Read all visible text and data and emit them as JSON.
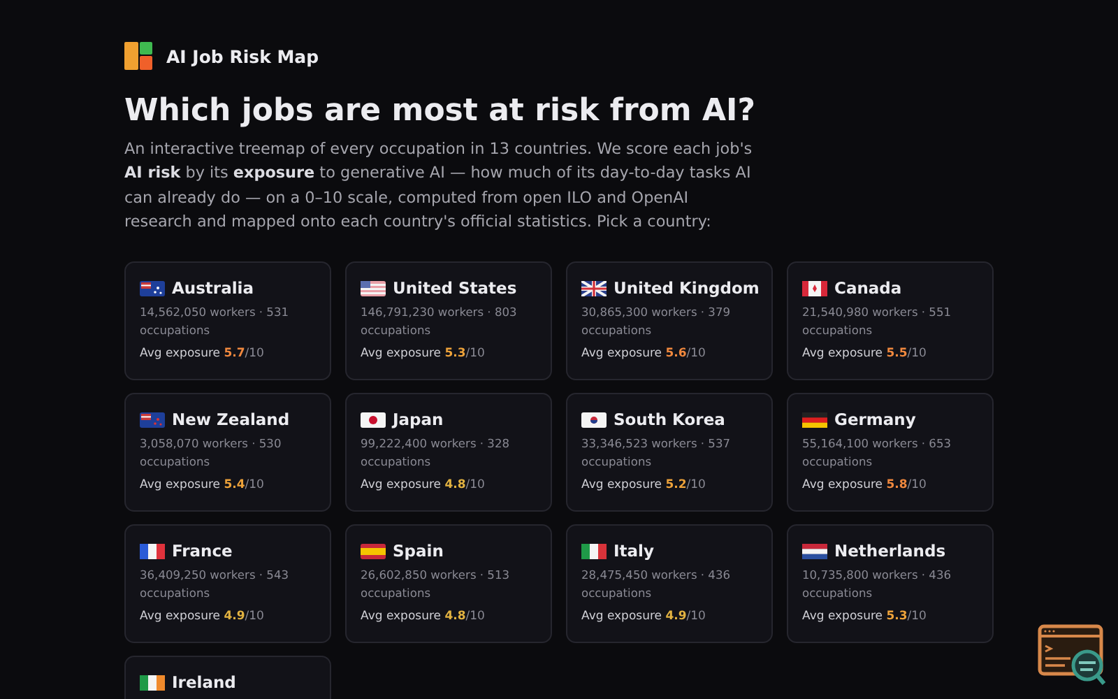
{
  "app": {
    "title": "AI Job Risk Map"
  },
  "heading": "Which jobs are most at risk from AI?",
  "intro": "An interactive treemap of every occupation in 13 countries. We score each job's **AI risk** by its **exposure** to generative AI — how much of its day-to-day tasks AI can already do — on a 0–10 scale, computed from open ILO and OpenAI research and mapped onto each country's official statistics. Pick a country:",
  "countries": [
    {
      "kind": "au",
      "name": "Australia",
      "stats": "14,562,050 workers · 531 occupations",
      "exposure_label": "Avg exposure",
      "score": "5.7",
      "scale": "/10"
    },
    {
      "kind": "us",
      "name": "United States",
      "stats": "146,791,230 workers · 803 occupations",
      "exposure_label": "Avg exposure",
      "score": "5.3",
      "scale": "/10"
    },
    {
      "kind": "gb",
      "name": "United Kingdom",
      "stats": "30,865,300 workers · 379 occupations",
      "exposure_label": "Avg exposure",
      "score": "5.6",
      "scale": "/10"
    },
    {
      "kind": "ca",
      "name": "Canada",
      "stats": "21,540,980 workers · 551 occupations",
      "exposure_label": "Avg exposure",
      "score": "5.5",
      "scale": "/10"
    },
    {
      "kind": "nz",
      "name": "New Zealand",
      "stats": "3,058,070 workers · 530 occupations",
      "exposure_label": "Avg exposure",
      "score": "5.4",
      "scale": "/10"
    },
    {
      "kind": "jp",
      "name": "Japan",
      "stats": "99,222,400 workers · 328 occupations",
      "exposure_label": "Avg exposure",
      "score": "4.8",
      "scale": "/10"
    },
    {
      "kind": "kr",
      "name": "South Korea",
      "stats": "33,346,523 workers · 537 occupations",
      "exposure_label": "Avg exposure",
      "score": "5.2",
      "scale": "/10"
    },
    {
      "kind": "de",
      "name": "Germany",
      "stats": "55,164,100 workers · 653 occupations",
      "exposure_label": "Avg exposure",
      "score": "5.8",
      "scale": "/10"
    },
    {
      "kind": "fr",
      "name": "France",
      "stats": "36,409,250 workers · 543 occupations",
      "exposure_label": "Avg exposure",
      "score": "4.9",
      "scale": "/10"
    },
    {
      "kind": "es",
      "name": "Spain",
      "stats": "26,602,850 workers · 513 occupations",
      "exposure_label": "Avg exposure",
      "score": "4.8",
      "scale": "/10"
    },
    {
      "kind": "it",
      "name": "Italy",
      "stats": "28,475,450 workers · 436 occupations",
      "exposure_label": "Avg exposure",
      "score": "4.9",
      "scale": "/10"
    },
    {
      "kind": "nl",
      "name": "Netherlands",
      "stats": "10,735,800 workers · 436 occupations",
      "exposure_label": "Avg exposure",
      "score": "5.3",
      "scale": "/10"
    },
    {
      "kind": "ie",
      "name": "Ireland"
    }
  ]
}
